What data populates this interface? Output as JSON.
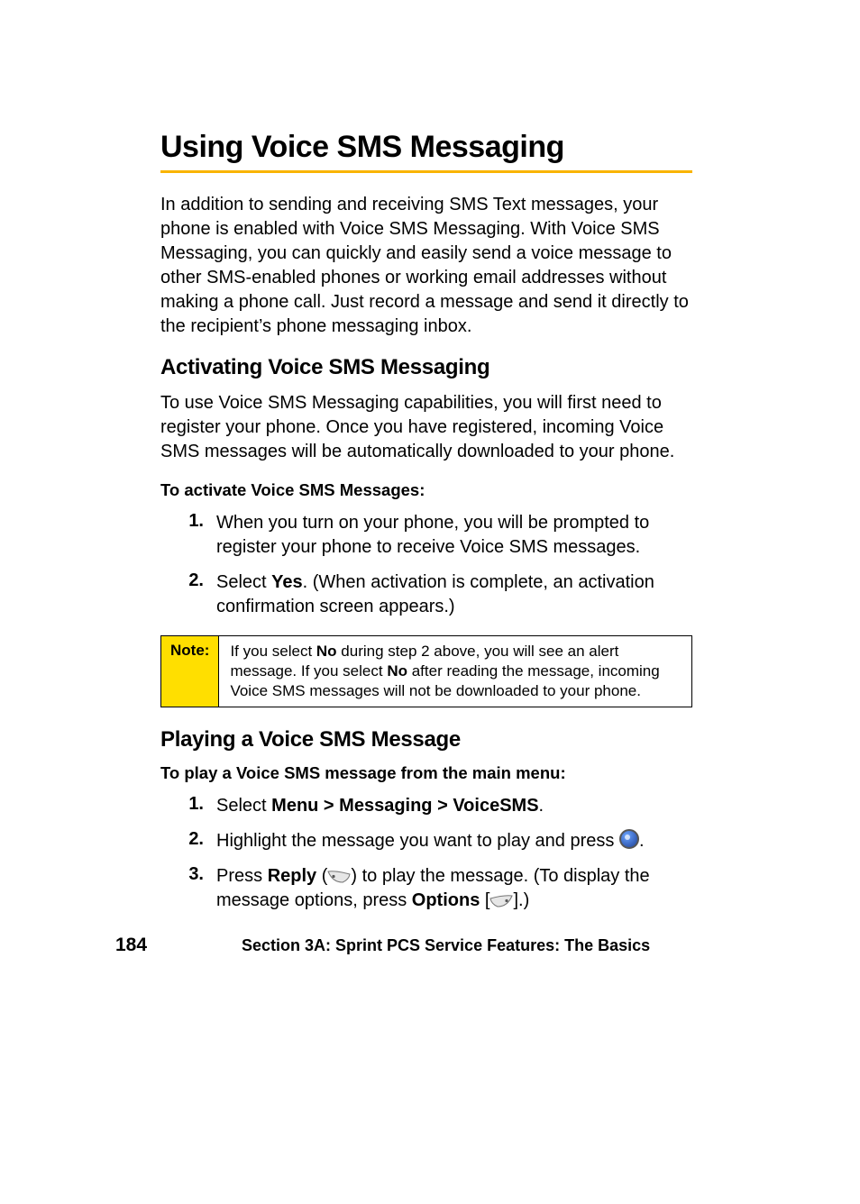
{
  "title": "Using Voice SMS Messaging",
  "intro": "In addition to sending and receiving SMS Text messages, your phone is enabled with Voice SMS Messaging. With Voice SMS Messaging, you can quickly and easily send a voice message to other SMS-enabled phones or working email addresses without making a phone call. Just record a message and send it directly to the recipient’s phone messaging inbox.",
  "section1": {
    "heading": "Activating Voice SMS Messaging",
    "body": "To use Voice SMS Messaging capabilities, you will first need to register your phone. Once you have registered, incoming Voice SMS messages will be automatically downloaded to your phone.",
    "lead": "To activate Voice SMS Messages:",
    "steps": [
      {
        "num": "1.",
        "text": "When you turn on your phone, you will be prompted to register your phone to receive Voice SMS messages."
      },
      {
        "num": "2.",
        "pre": "Select ",
        "bold": "Yes",
        "post": ". (When activation is complete, an activation confirmation screen appears.)"
      }
    ],
    "note": {
      "label": "Note:",
      "text_1a": "If you select ",
      "text_1b": "No",
      "text_1c": " during step 2 above, you will see an alert message. If you select ",
      "text_1d": "No",
      "text_1e": " after reading the message, incoming Voice SMS messages will not be downloaded to your phone."
    }
  },
  "section2": {
    "heading": "Playing a Voice SMS Message",
    "lead": "To play a Voice SMS message from the main menu:",
    "steps": [
      {
        "num": "1.",
        "pre": "Select ",
        "bold": "Menu > Messaging > VoiceSMS",
        "post": "."
      },
      {
        "num": "2.",
        "pre": "Highlight the message you want to play and press ",
        "icon": "ok",
        "post": "."
      },
      {
        "num": "3.",
        "pre": "Press ",
        "bold": "Reply",
        "mid1": " (",
        "icon1": "left-softkey",
        "mid2": ") to play the message. (To display the message options, press ",
        "bold2": "Options",
        "mid3": " [",
        "icon2": "right-softkey",
        "post": "].)"
      }
    ]
  },
  "footer": {
    "page": "184",
    "text": "Section 3A: Sprint PCS Service Features: The Basics"
  }
}
